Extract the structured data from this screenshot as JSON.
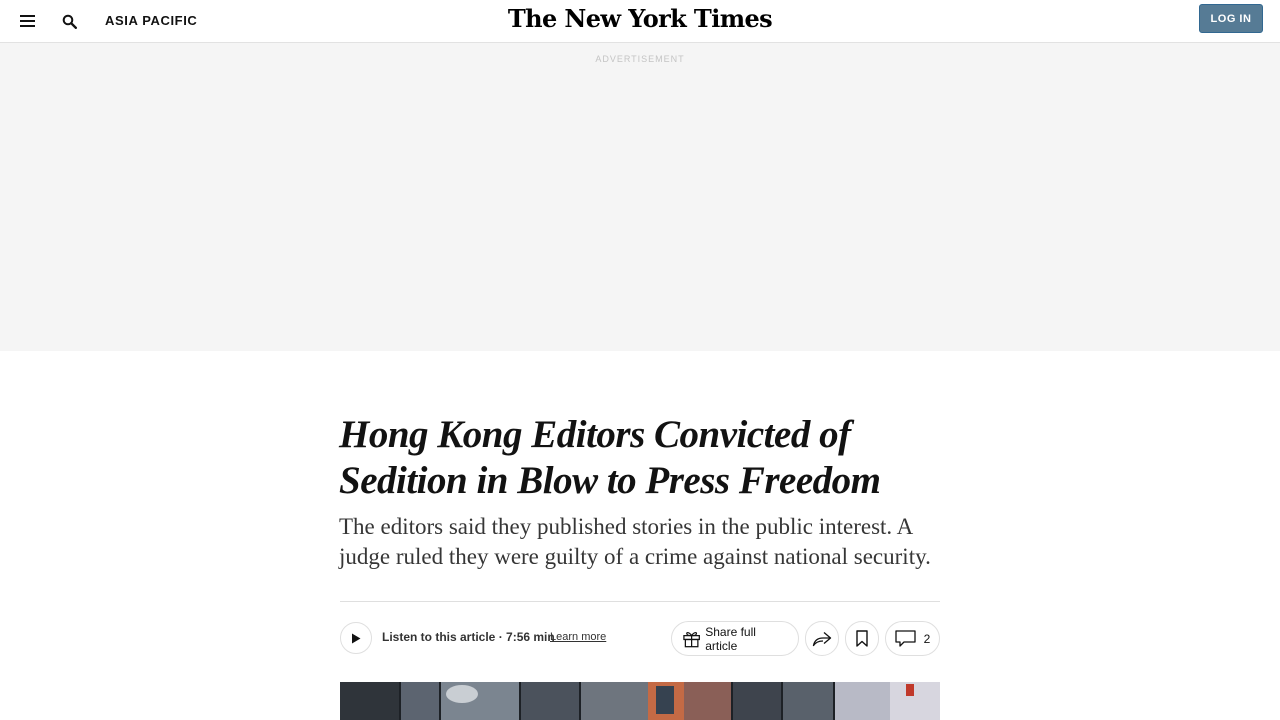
{
  "header": {
    "section": "ASIA PACIFIC",
    "logo": "The New York Times",
    "login_label": "LOG IN",
    "icons": {
      "menu": "menu-icon",
      "search": "search-icon"
    }
  },
  "ad": {
    "label": "ADVERTISEMENT"
  },
  "article": {
    "headline": "Hong Kong Editors Convicted of Sedition in Blow to Press Freedom",
    "summary": "The editors said they published stories in the public interest. A judge ruled they were guilty of a crime against national security."
  },
  "toolbar": {
    "listen_text": "Listen to this article · 7:56 min",
    "learn_more": "Learn more",
    "share_full": "Share full article",
    "comment_count": "2",
    "icons": {
      "play": "play-icon",
      "gift": "gift-icon",
      "share": "share-arrow-icon",
      "bookmark": "bookmark-icon",
      "comment": "comment-icon"
    }
  },
  "colors": {
    "login_bg": "#567b95",
    "ad_bg": "#f5f5f5",
    "text": "#121212"
  }
}
